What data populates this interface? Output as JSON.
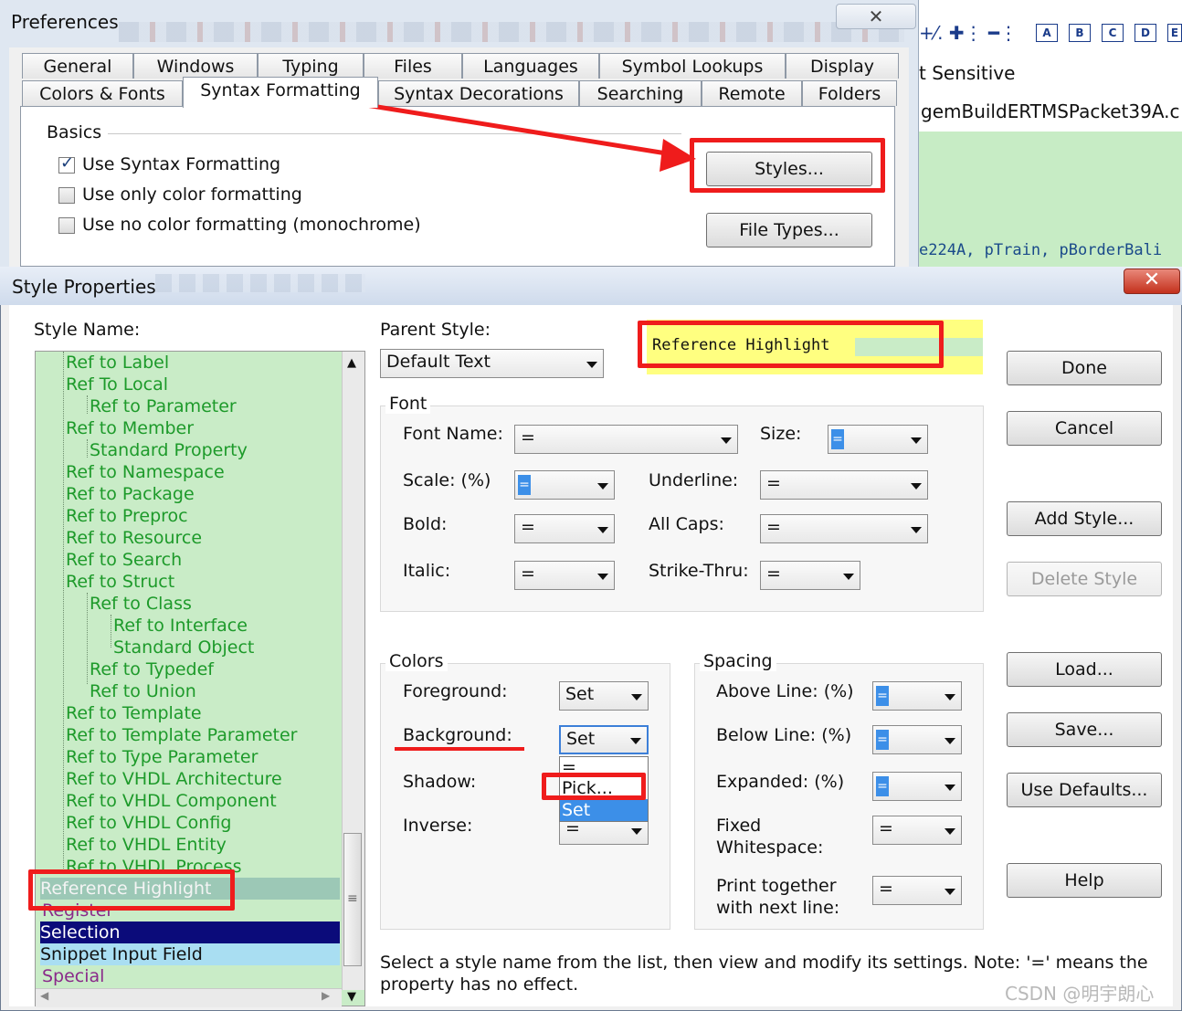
{
  "prefs": {
    "title": "Preferences",
    "close_glyph": "✕",
    "tabs_row1": [
      "General",
      "Windows",
      "Typing",
      "Files",
      "Languages",
      "Symbol Lookups",
      "Display"
    ],
    "tabs_row2": [
      "Colors & Fonts",
      "Syntax Formatting",
      "Syntax Decorations",
      "Searching",
      "Remote",
      "Folders"
    ],
    "active_tab": "Syntax Formatting",
    "basics_label": "Basics",
    "options": [
      {
        "label": "Use Syntax Formatting",
        "checked": true
      },
      {
        "label": "Use only color formatting",
        "checked": false
      },
      {
        "label": "Use no color formatting (monochrome)",
        "checked": false
      }
    ],
    "styles_button": "Styles...",
    "file_types_button": "File Types..."
  },
  "editor": {
    "case_label": "t Sensitive",
    "file_label": "gemBuildERTMSPacket39A.c (",
    "code_line": "e224A, pTrain, pBorderBali",
    "toolbar_letters": [
      "A",
      "B",
      "C",
      "D",
      "E"
    ]
  },
  "style_props": {
    "title": "Style Properties",
    "style_name_label": "Style Name:",
    "tree_items": [
      {
        "label": "Ref to Label",
        "level": 1
      },
      {
        "label": "Ref To Local",
        "level": 1
      },
      {
        "label": "Ref to Parameter",
        "level": 2
      },
      {
        "label": "Ref to Member",
        "level": 1
      },
      {
        "label": "Standard Property",
        "level": 2
      },
      {
        "label": "Ref to Namespace",
        "level": 1
      },
      {
        "label": "Ref to Package",
        "level": 1
      },
      {
        "label": "Ref to Preproc",
        "level": 1
      },
      {
        "label": "Ref to Resource",
        "level": 1
      },
      {
        "label": "Ref to Search",
        "level": 1
      },
      {
        "label": "Ref to Struct",
        "level": 1
      },
      {
        "label": "Ref to Class",
        "level": 2
      },
      {
        "label": "Ref to Interface",
        "level": 3
      },
      {
        "label": "Standard Object",
        "level": 3
      },
      {
        "label": "Ref to Typedef",
        "level": 2
      },
      {
        "label": "Ref to Union",
        "level": 2
      },
      {
        "label": "Ref to Template",
        "level": 1
      },
      {
        "label": "Ref to Template Parameter",
        "level": 1
      },
      {
        "label": "Ref to Type Parameter",
        "level": 1
      },
      {
        "label": "Ref to VHDL Architecture",
        "level": 1
      },
      {
        "label": "Ref to VHDL Component",
        "level": 1
      },
      {
        "label": "Ref to VHDL Config",
        "level": 1
      },
      {
        "label": "Ref to VHDL Entity",
        "level": 1
      },
      {
        "label": "Ref to VHDL Process",
        "level": 1
      }
    ],
    "tree_bottom": [
      {
        "label": "Reference Highlight",
        "kind": "refhl"
      },
      {
        "label": "Register",
        "kind": "purple"
      },
      {
        "label": "Selection",
        "kind": "sel"
      },
      {
        "label": "Snippet Input Field",
        "kind": "snip"
      },
      {
        "label": "Special",
        "kind": "purple"
      }
    ],
    "parent_style_label": "Parent Style:",
    "parent_style_value": "Default Text",
    "preview_text": "Reference Highlight",
    "buttons": {
      "done": "Done",
      "cancel": "Cancel",
      "add_style": "Add Style...",
      "delete_style": "Delete Style",
      "load": "Load...",
      "save": "Save...",
      "use_defaults": "Use Defaults...",
      "help": "Help"
    },
    "font": {
      "group": "Font",
      "font_name_label": "Font Name:",
      "font_name_value": "=",
      "size_label": "Size:",
      "size_value": "=",
      "scale_label": "Scale: (%)",
      "scale_value": "=",
      "underline_label": "Underline:",
      "underline_value": "=",
      "bold_label": "Bold:",
      "bold_value": "=",
      "allcaps_label": "All Caps:",
      "allcaps_value": "=",
      "italic_label": "Italic:",
      "italic_value": "=",
      "strike_label": "Strike-Thru:",
      "strike_value": "="
    },
    "colors": {
      "group": "Colors",
      "fg_label": "Foreground:",
      "fg_value": "Set",
      "bg_label": "Background:",
      "bg_value": "Set",
      "shadow_label": "Shadow:",
      "inverse_label": "Inverse:",
      "inverse_value": "=",
      "bg_options": [
        "=",
        "Pick...",
        "Set"
      ]
    },
    "spacing": {
      "group": "Spacing",
      "above_label": "Above Line: (%)",
      "above_value": "=",
      "below_label": "Below Line: (%)",
      "below_value": "=",
      "expanded_label": "Expanded: (%)",
      "expanded_value": "=",
      "fixed_label_1": "Fixed",
      "fixed_label_2": "Whitespace:",
      "fixed_value": "=",
      "print_label_1": "Print together",
      "print_label_2": "with next line:",
      "print_value": "="
    },
    "hint_line1": "Select a style name from the list, then view and modify its settings. Note: '=' means the",
    "hint_line2": "property has no effect."
  },
  "watermark": "CSDN @明宇朗心",
  "colors": {
    "annotation_red": "#ef1c1c",
    "tree_green": "#1d9a2a",
    "selection_navy": "#0b0b7a",
    "preview_yellow": "#ffff80"
  }
}
